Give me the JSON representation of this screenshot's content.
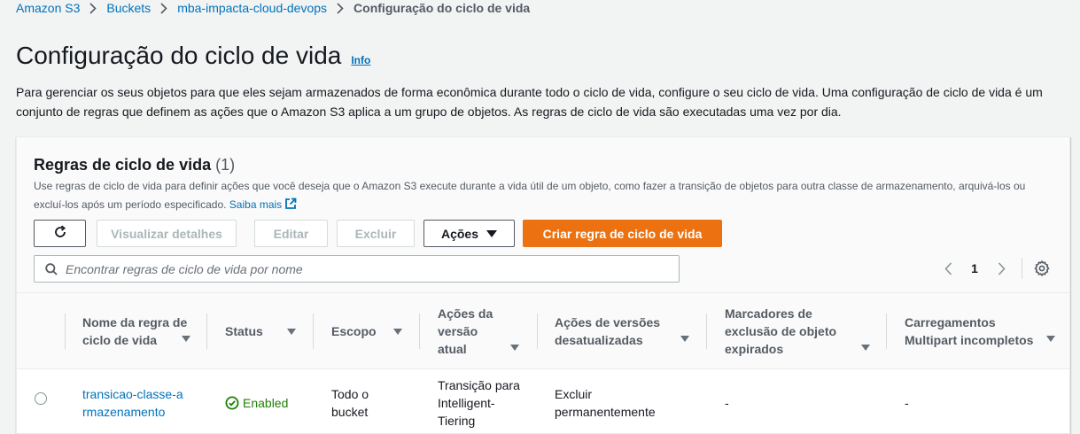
{
  "breadcrumb": {
    "items": [
      "Amazon S3",
      "Buckets",
      "mba-impacta-cloud-devops"
    ],
    "current": "Configuração do ciclo de vida"
  },
  "page": {
    "title": "Configuração do ciclo de vida",
    "info_label": "Info",
    "description": "Para gerenciar os seus objetos para que eles sejam armazenados de forma econômica durante todo o ciclo de vida, configure o seu ciclo de vida. Uma configuração de ciclo de vida é um conjunto de regras que definem as ações que o Amazon S3 aplica a um grupo de objetos. As regras de ciclo de vida são executadas uma vez por dia."
  },
  "rules_panel": {
    "title": "Regras de ciclo de vida",
    "count": "(1)",
    "description": "Use regras de ciclo de vida para definir ações que você deseja que o Amazon S3 execute durante a vida útil de um objeto, como fazer a transição de objetos para outra classe de armazenamento, arquivá-los ou excluí-los após um período especificado.",
    "learn_more": "Saiba mais",
    "buttons": {
      "refresh_icon": "refresh-icon",
      "view_details": "Visualizar detalhes",
      "edit": "Editar",
      "delete": "Excluir",
      "actions": "Ações",
      "create": "Criar regra de ciclo de vida"
    },
    "search": {
      "placeholder": "Encontrar regras de ciclo de vida por nome",
      "value": ""
    },
    "pagination": {
      "current_page": "1"
    },
    "columns": [
      "Nome da regra de ciclo de vida",
      "Status",
      "Escopo",
      "Ações da versão atual",
      "Ações de versões desatualizadas",
      "Marcadores de exclusão de objeto expirados",
      "Carregamentos Multipart incompletos"
    ],
    "rows": [
      {
        "name": "transicao-classe-armazenamento",
        "status": "Enabled",
        "scope": "Todo o bucket",
        "current_version_actions": "Transição para Intelligent-Tiering",
        "noncurrent_version_actions": "Excluir permanentemente",
        "expired_delete_markers": "-",
        "incomplete_multipart": "-"
      }
    ]
  },
  "colors": {
    "link": "#0073bb",
    "primary_button": "#ec7211",
    "status_enabled": "#1d8102",
    "background": "#f2f3f3"
  }
}
